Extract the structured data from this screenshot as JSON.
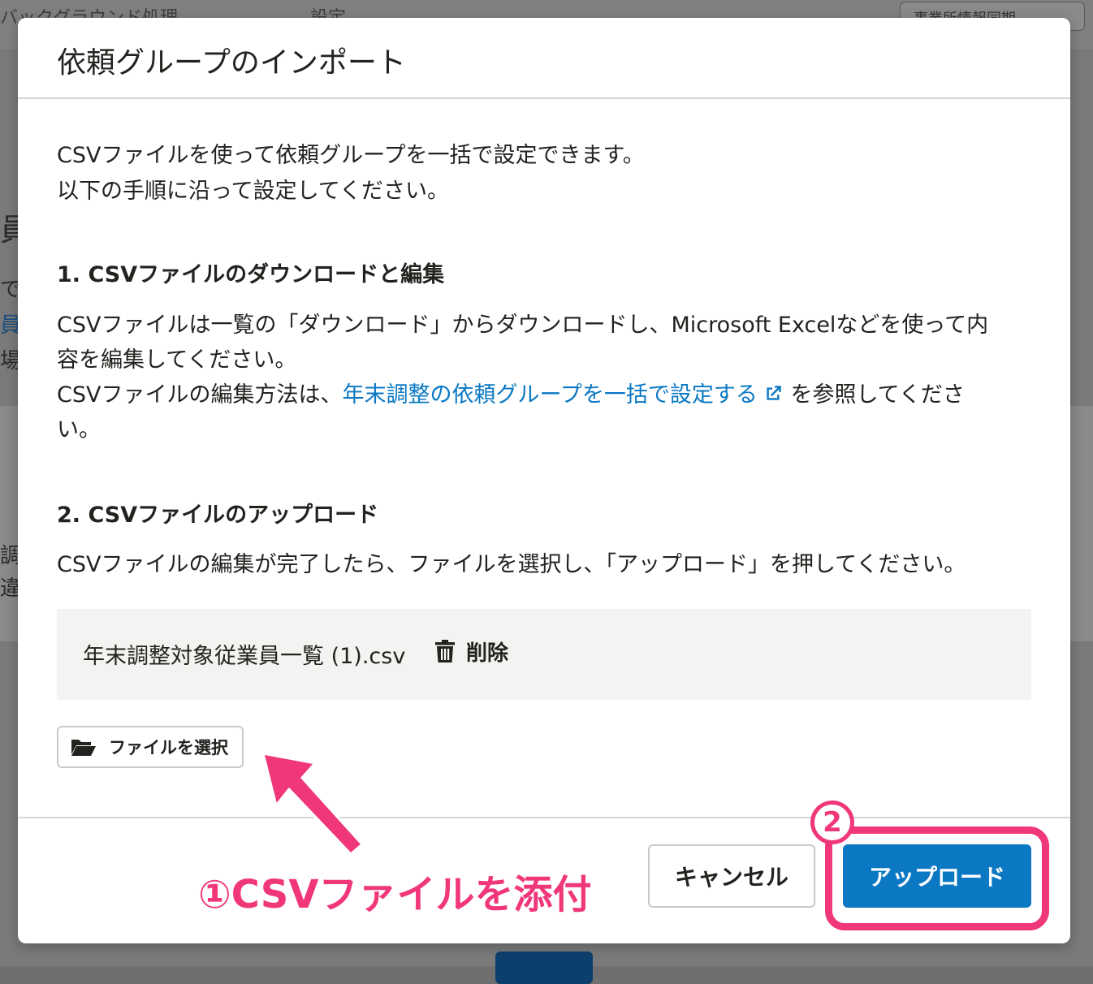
{
  "background": {
    "tabs": [
      "バックグラウンド処理",
      "設定"
    ],
    "sync_button": "事業所情報同期",
    "side_glyphs": [
      "員",
      "で",
      "員",
      "場",
      "調",
      "違"
    ]
  },
  "modal": {
    "title": "依頼グループのインポート",
    "intro_line1": "CSVファイルを使って依頼グループを一括で設定できます。",
    "intro_line2": "以下の手順に沿って設定してください。",
    "section1": {
      "title": "1. CSVファイルのダウンロードと編集",
      "line1": "CSVファイルは一覧の「ダウンロード」からダウンロードし、Microsoft Excelなどを使って内",
      "line2": "容を編集してください。",
      "line3_prefix": "CSVファイルの編集方法は、",
      "link_text": "年末調整の依頼グループを一括で設定する",
      "line3_suffix": "を参照してくださ",
      "line4": "い。"
    },
    "section2": {
      "title": "2. CSVファイルのアップロード",
      "line1": "CSVファイルの編集が完了したら、ファイルを選択し、「アップロード」を押してください。"
    },
    "file": {
      "name": "年末調整対象従業員一覧 (1).csv",
      "delete_label": "削除"
    },
    "select_file_label": "ファイルを選択",
    "cancel_label": "キャンセル",
    "upload_label": "アップロード"
  },
  "annotations": {
    "step1": "①CSVファイルを添付",
    "step2": "2",
    "color": "#f0377a"
  },
  "colors": {
    "primary": "#0a78c3",
    "link": "#0a78c3",
    "annotation": "#f0377a"
  },
  "icons": {
    "delete": "trash-icon",
    "select": "folder-open-icon",
    "link": "external-link-icon"
  }
}
